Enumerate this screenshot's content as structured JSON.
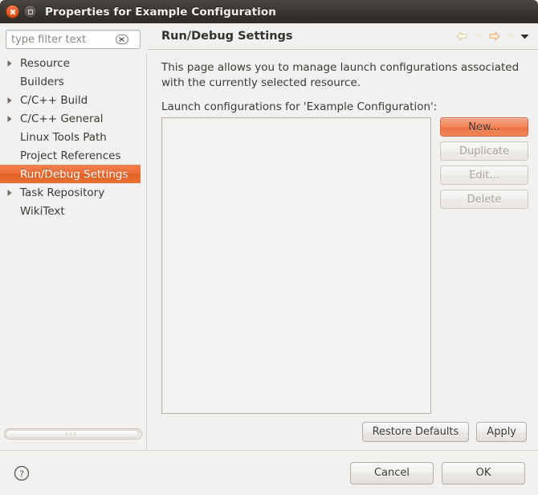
{
  "window": {
    "title": "Properties for Example Configuration",
    "close_tooltip": "Close",
    "maximize_tooltip": "Maximize"
  },
  "sidebar": {
    "filter": {
      "value": "",
      "placeholder": "type filter text",
      "clear_icon": "clear-text-icon"
    },
    "items": [
      {
        "label": "Resource",
        "expandable": true,
        "selected": false
      },
      {
        "label": "Builders",
        "expandable": false,
        "selected": false
      },
      {
        "label": "C/C++ Build",
        "expandable": true,
        "selected": false
      },
      {
        "label": "C/C++ General",
        "expandable": true,
        "selected": false
      },
      {
        "label": "Linux Tools Path",
        "expandable": false,
        "selected": false
      },
      {
        "label": "Project References",
        "expandable": false,
        "selected": false
      },
      {
        "label": "Run/Debug Settings",
        "expandable": false,
        "selected": true
      },
      {
        "label": "Task Repository",
        "expandable": true,
        "selected": false
      },
      {
        "label": "WikiText",
        "expandable": false,
        "selected": false
      }
    ],
    "selected_color": "#ed6d35"
  },
  "page": {
    "title": "Run/Debug Settings",
    "nav_icons": [
      {
        "name": "back-arrow-icon",
        "state": "disabled"
      },
      {
        "name": "back-dropdown-icon",
        "state": "disabled"
      },
      {
        "name": "forward-arrow-icon",
        "state": "disabled"
      },
      {
        "name": "forward-dropdown-icon",
        "state": "disabled"
      },
      {
        "name": "menu-dropdown-icon",
        "state": "enabled"
      }
    ],
    "description_line1": "This page allows you to manage launch configurations associated",
    "description_line2": "with the currently selected resource.",
    "list_label": "Launch configurations for 'Example Configuration':",
    "list_items": [],
    "side_buttons": [
      {
        "label": "New...",
        "state": "default"
      },
      {
        "label": "Duplicate",
        "state": "disabled"
      },
      {
        "label": "Edit...",
        "state": "disabled"
      },
      {
        "label": "Delete",
        "state": "disabled"
      }
    ],
    "bottom_buttons": [
      {
        "label": "Restore Defaults",
        "state": "enabled"
      },
      {
        "label": "Apply",
        "state": "enabled"
      }
    ]
  },
  "footer": {
    "help_icon": "help-question-icon",
    "buttons": [
      {
        "label": "Cancel",
        "state": "enabled"
      },
      {
        "label": "OK",
        "state": "enabled"
      }
    ]
  }
}
